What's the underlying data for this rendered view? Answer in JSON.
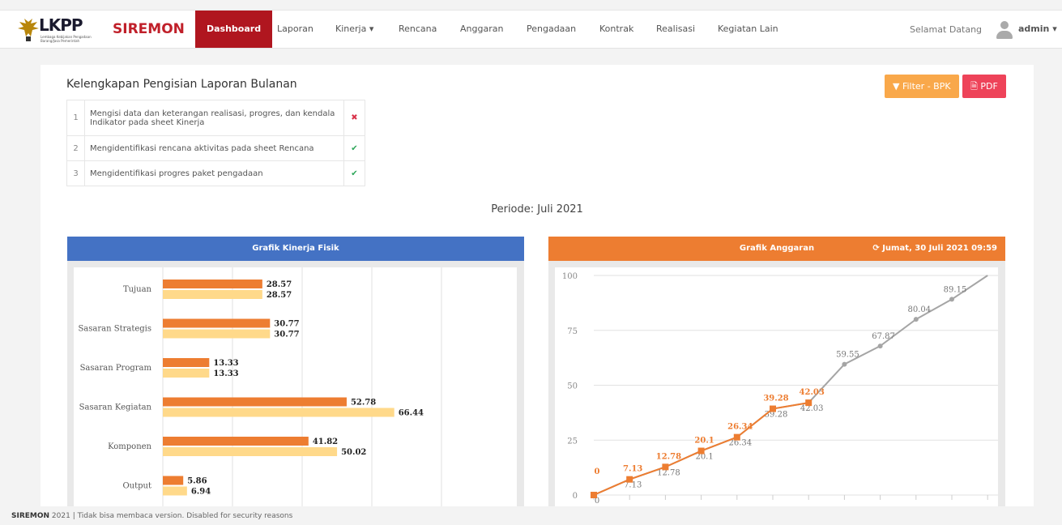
{
  "header": {
    "logo_text": "LKPP",
    "logo_subtitle": "Lembaga Kebijakan Pengadaan Barang/Jasa Pemerintah",
    "brand": "SIREMON",
    "nav": [
      {
        "label": "Dashboard",
        "active": true
      },
      {
        "label": "Laporan"
      },
      {
        "label": "Kinerja ▾"
      },
      {
        "label": "Rencana"
      },
      {
        "label": "Anggaran"
      },
      {
        "label": "Pengadaan"
      },
      {
        "label": "Kontrak"
      },
      {
        "label": "Realisasi"
      },
      {
        "label": "Kegiatan Lain"
      }
    ],
    "welcome": "Selamat Datang",
    "user": "admin ▾"
  },
  "checklist": {
    "title": "Kelengkapan Pengisian Laporan Bulanan",
    "items": [
      {
        "no": "1",
        "text": "Mengisi data dan keterangan realisasi, progres, dan kendala Indikator pada sheet Kinerja",
        "status": "✖",
        "done": false
      },
      {
        "no": "2",
        "text": "Mengidentifikasi rencana aktivitas pada sheet Rencana",
        "status": "✔",
        "done": true
      },
      {
        "no": "3",
        "text": "Mengidentifikasi progres paket pengadaan",
        "status": "✔",
        "done": true
      }
    ]
  },
  "buttons": {
    "filter": "▼ Filter - BPK",
    "pdf": "🗎 PDF"
  },
  "periode": "Periode: Juli 2021",
  "kinerja_panel": {
    "title": "Grafik Kinerja Fisik"
  },
  "anggaran_panel": {
    "title": "Grafik Anggaran",
    "updated": "⟳ Jumat, 30 Juli 2021 09:59"
  },
  "chart_data": [
    {
      "type": "bar",
      "orientation": "horizontal",
      "categories": [
        "Tujuan",
        "Sasaran Strategis",
        "Sasaran Program",
        "Sasaran Kegiatan",
        "Komponen",
        "Output"
      ],
      "series": [
        {
          "values": [
            28.57,
            30.77,
            13.33,
            52.78,
            41.82,
            5.86
          ],
          "color": "#ed7d31"
        },
        {
          "values": [
            28.57,
            30.77,
            13.33,
            66.44,
            50.02,
            6.94
          ],
          "color": "#ffd98a"
        }
      ],
      "xlim": [
        0,
        100
      ],
      "grid": true
    },
    {
      "type": "line",
      "y_ticks": [
        0,
        25,
        50,
        75,
        100
      ],
      "ylim": [
        0,
        100
      ],
      "series": [
        {
          "values": [
            0,
            7.13,
            12.78,
            20.1,
            26.34,
            39.28,
            42.03
          ],
          "color": "#ed7d31",
          "labels": [
            "0",
            "7.13",
            "12.78",
            "20.1",
            "26.34",
            "39.28",
            "42.03"
          ]
        },
        {
          "values": [
            0,
            7.13,
            12.78,
            20.1,
            26.34,
            39.28,
            42.03,
            59.55,
            67.87,
            80.04,
            89.15,
            100
          ],
          "color": "#a5a5a5",
          "labels": [
            "0",
            "7.13",
            "12.78",
            "20.1",
            "26.34",
            "39.28",
            "42.03",
            "59.55",
            "67.87",
            "80.04",
            "89.15"
          ]
        }
      ],
      "grid": true
    }
  ],
  "footer": {
    "brand": "SIREMON",
    "text": " 2021 | Tidak bisa membaca version. Disabled for security reasons"
  }
}
